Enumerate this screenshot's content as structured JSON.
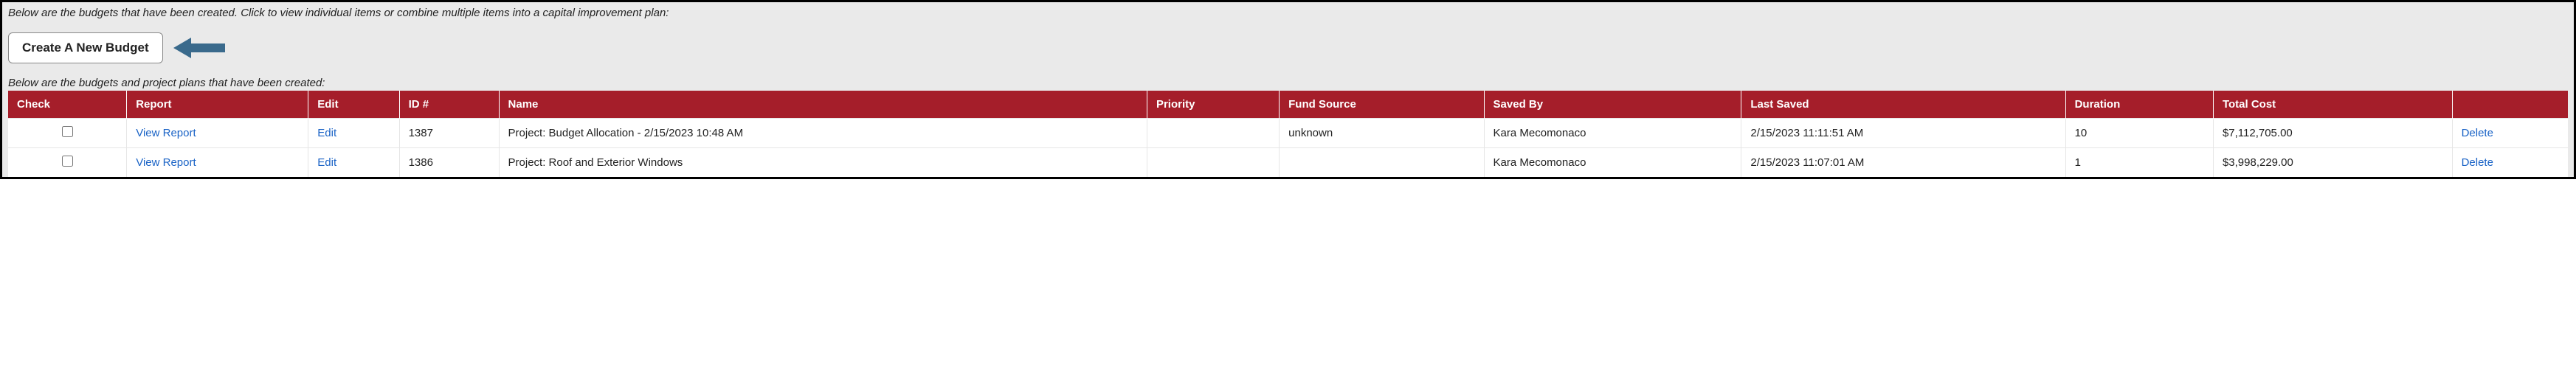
{
  "intro_text": "Below are the budgets that have been created. Click to view individual items or combine multiple items into a capital improvement plan:",
  "create_button_label": "Create A New Budget",
  "sub_intro_text": "Below are the budgets and project plans that have been created:",
  "arrow_color": "#3a6a8c",
  "columns": {
    "check": "Check",
    "report": "Report",
    "edit": "Edit",
    "id": "ID #",
    "name": "Name",
    "priority": "Priority",
    "fund_source": "Fund Source",
    "saved_by": "Saved By",
    "last_saved": "Last Saved",
    "duration": "Duration",
    "total_cost": "Total Cost",
    "actions": ""
  },
  "link_labels": {
    "view_report": "View Report",
    "edit": "Edit",
    "delete": "Delete"
  },
  "rows": [
    {
      "id": "1387",
      "name": "Project: Budget Allocation - 2/15/2023 10:48 AM",
      "priority": "",
      "fund_source": "unknown",
      "saved_by": "Kara Mecomonaco",
      "last_saved": "2/15/2023 11:11:51 AM",
      "duration": "10",
      "total_cost": "$7,112,705.00"
    },
    {
      "id": "1386",
      "name": "Project: Roof and Exterior Windows",
      "priority": "",
      "fund_source": "",
      "saved_by": "Kara Mecomonaco",
      "last_saved": "2/15/2023 11:07:01 AM",
      "duration": "1",
      "total_cost": "$3,998,229.00"
    }
  ]
}
